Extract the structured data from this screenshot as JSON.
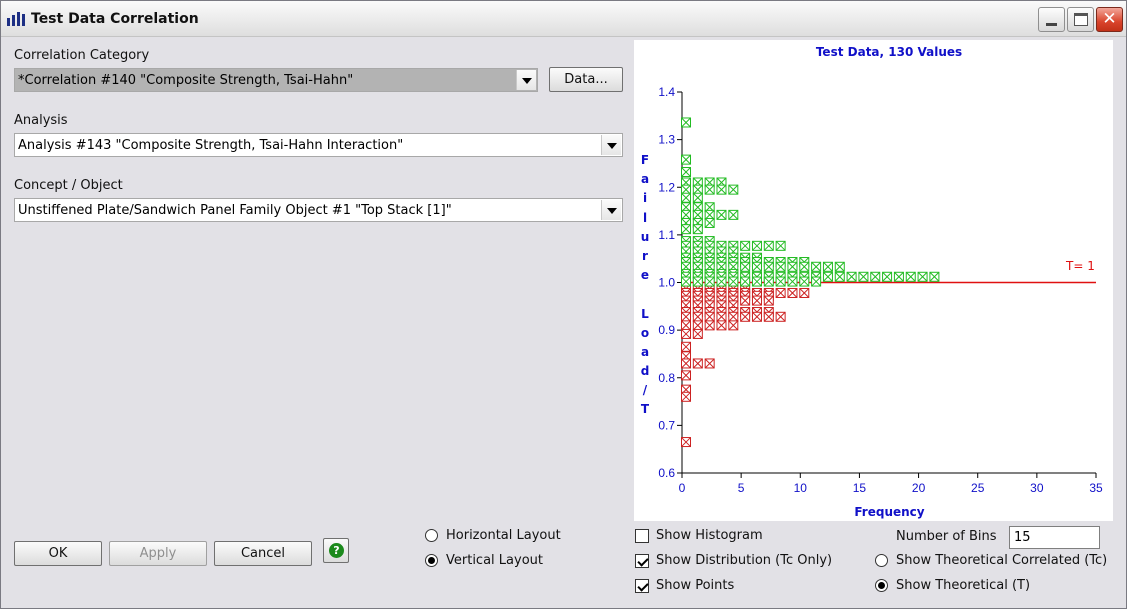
{
  "window": {
    "title": "Test Data Correlation",
    "icon": "bar-chart-icon"
  },
  "correlation": {
    "label": "Correlation Category",
    "value": "*Correlation #140 \"Composite Strength, Tsai-Hahn\"",
    "data_button": "Data..."
  },
  "analysis": {
    "label": "Analysis",
    "value": "Analysis #143 \"Composite Strength, Tsai-Hahn Interaction\""
  },
  "concept": {
    "label": "Concept / Object",
    "value": "Unstiffened Plate/Sandwich Panel Family Object #1 \"Top Stack [1]\""
  },
  "buttons": {
    "ok": "OK",
    "apply": "Apply",
    "cancel": "Cancel"
  },
  "layout": {
    "horizontal": "Horizontal Layout",
    "vertical": "Vertical Layout",
    "selected": "vertical"
  },
  "options": {
    "show_histogram": {
      "label": "Show Histogram",
      "checked": false
    },
    "show_distribution": {
      "label": "Show Distribution (Tc Only)",
      "checked": true
    },
    "show_points": {
      "label": "Show Points",
      "checked": true
    },
    "number_of_bins_label": "Number of Bins",
    "number_of_bins_value": "15",
    "theoretical_correlated": "Show Theoretical Correlated (Tc)",
    "theoretical": "Show Theoretical (T)",
    "theoretical_selected": "theoretical"
  },
  "chart_data": {
    "type": "scatter",
    "title": "Test Data, 130 Values",
    "xlabel": "Frequency",
    "ylabel": "Failure Load/T",
    "xlim": [
      0,
      35
    ],
    "ylim": [
      0.6,
      1.4
    ],
    "xticks": [
      "0",
      "5",
      "10",
      "15",
      "20",
      "25",
      "30",
      "35"
    ],
    "yticks": [
      "0.6",
      "0.7",
      "0.8",
      "0.9",
      "1.0",
      "1.1",
      "1.2",
      "1.3",
      "1.4"
    ],
    "reference_line": {
      "label": "T= 1",
      "y": 1.0,
      "color": "#e01010"
    },
    "point_colors": {
      "above": "#22bb22",
      "below": "#cc2222"
    },
    "rows_above": [
      {
        "y": 1.336,
        "count": 1
      },
      {
        "y": 1.258,
        "count": 1
      },
      {
        "y": 1.232,
        "count": 1
      },
      {
        "y": 1.21,
        "count": 4
      },
      {
        "y": 1.195,
        "count": 5
      },
      {
        "y": 1.178,
        "count": 2
      },
      {
        "y": 1.158,
        "count": 3
      },
      {
        "y": 1.142,
        "count": 5
      },
      {
        "y": 1.125,
        "count": 3
      },
      {
        "y": 1.112,
        "count": 2
      },
      {
        "y": 1.087,
        "count": 3
      },
      {
        "y": 1.077,
        "count": 9
      },
      {
        "y": 1.065,
        "count": 5
      },
      {
        "y": 1.052,
        "count": 7
      },
      {
        "y": 1.043,
        "count": 11
      },
      {
        "y": 1.033,
        "count": 14
      },
      {
        "y": 1.018,
        "count": 5
      },
      {
        "y": 1.012,
        "count": 22
      },
      {
        "y": 1.002,
        "count": 12
      }
    ],
    "rows_below": [
      {
        "y": 0.995,
        "count": 1
      },
      {
        "y": 0.987,
        "count": 6
      },
      {
        "y": 0.978,
        "count": 11
      },
      {
        "y": 0.972,
        "count": 8
      },
      {
        "y": 0.962,
        "count": 8
      },
      {
        "y": 0.952,
        "count": 5
      },
      {
        "y": 0.938,
        "count": 8
      },
      {
        "y": 0.928,
        "count": 9
      },
      {
        "y": 0.91,
        "count": 5
      },
      {
        "y": 0.892,
        "count": 2
      },
      {
        "y": 0.865,
        "count": 1
      },
      {
        "y": 0.845,
        "count": 1
      },
      {
        "y": 0.83,
        "count": 3
      },
      {
        "y": 0.805,
        "count": 1
      },
      {
        "y": 0.775,
        "count": 1
      },
      {
        "y": 0.76,
        "count": 1
      },
      {
        "y": 0.665,
        "count": 1
      }
    ]
  }
}
